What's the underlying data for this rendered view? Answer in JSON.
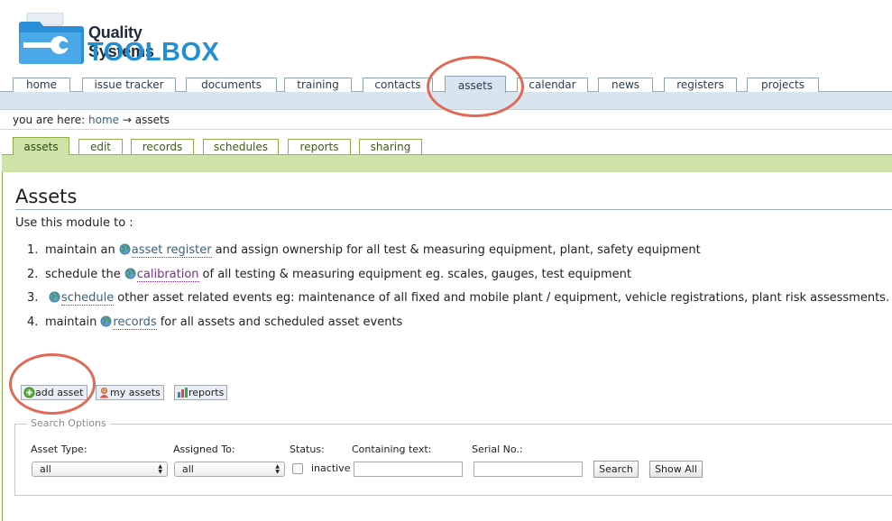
{
  "logo": {
    "line1": "Quality Systems",
    "line2": "TOOLBOX"
  },
  "topnav": {
    "tabs": [
      "home",
      "issue tracker",
      "documents",
      "training",
      "contacts",
      "assets",
      "calendar",
      "news",
      "registers",
      "projects"
    ],
    "active": "assets"
  },
  "breadcrumb": {
    "prefix": "you are here:",
    "home": "home",
    "arrow": "→",
    "current": "assets"
  },
  "subnav": {
    "tabs": [
      "assets",
      "edit",
      "records",
      "schedules",
      "reports",
      "sharing"
    ],
    "active": "assets"
  },
  "page": {
    "title": "Assets",
    "intro": "Use this module to :",
    "items": [
      {
        "num": "1.",
        "before": "maintain an",
        "link": "asset register",
        "after": "and assign ownership for all test & measuring equipment, plant, safety equipment"
      },
      {
        "num": "2.",
        "before": "schedule the",
        "link": "calibration",
        "after": "of all testing & measuring equipment eg. scales, gauges, test equipment"
      },
      {
        "num": "3.",
        "before": "",
        "link": "schedule",
        "after": "other asset related events eg: maintenance of all fixed and mobile plant / equipment, vehicle registrations, plant risk assessments."
      },
      {
        "num": "4.",
        "before": "maintain",
        "link": "records",
        "after": "for all assets and scheduled asset events"
      }
    ]
  },
  "actions": {
    "add_asset": "add asset",
    "my_assets": "my assets",
    "reports": "reports"
  },
  "search": {
    "legend": "Search Options",
    "asset_type_label": "Asset Type:",
    "asset_type_value": "all",
    "assigned_to_label": "Assigned To:",
    "assigned_to_value": "all",
    "status_label": "Status:",
    "inactive_label": "inactive",
    "inactive_checked": false,
    "containing_text_label": "Containing text:",
    "containing_text_value": "",
    "serial_label": "Serial No.:",
    "serial_value": "",
    "search_button": "Search",
    "show_all_button": "Show All"
  },
  "colors": {
    "brand_blue": "#1f8fd6",
    "link": "#3d5f7a",
    "visited_link": "#7a2d8e",
    "subnav_green": "#cfe3a9",
    "topnav_blue": "#d8e4ee",
    "highlight_circle": "#e06a55"
  }
}
